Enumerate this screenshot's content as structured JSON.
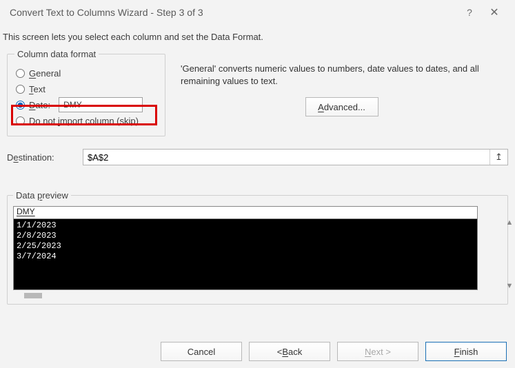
{
  "title": "Convert Text to Columns Wizard - Step 3 of 3",
  "instruction": "This screen lets you select each column and set the Data Format.",
  "format": {
    "legend": "Column data format",
    "general": "General",
    "text": "Text",
    "date": "Date:",
    "date_order": "DMY",
    "skip": "Do not import column (skip)"
  },
  "hint": "'General' converts numeric values to numbers, date values to dates, and all remaining values to text.",
  "advanced": "Advanced...",
  "destination": {
    "label": "Destination:",
    "value": "$A$2"
  },
  "preview": {
    "legend": "Data preview",
    "header": "DMY",
    "rows": [
      "1/1/2023",
      "2/8/2023",
      "2/25/2023",
      "3/7/2024"
    ]
  },
  "buttons": {
    "cancel": "Cancel",
    "back": "< Back",
    "next": "Next >",
    "finish": "Finish"
  }
}
